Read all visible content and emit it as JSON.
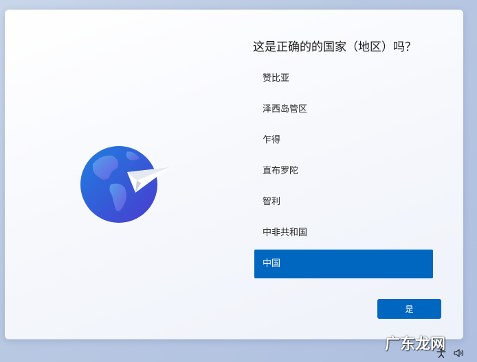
{
  "dialog": {
    "title": "这是正确的的国家（地区）吗？",
    "hero_icon": "globe-with-paper-plane-icon"
  },
  "regions": {
    "items": [
      {
        "label": "赞比亚",
        "selected": false
      },
      {
        "label": "泽西岛管区",
        "selected": false
      },
      {
        "label": "乍得",
        "selected": false
      },
      {
        "label": "直布罗陀",
        "selected": false
      },
      {
        "label": "智利",
        "selected": false
      },
      {
        "label": "中非共和国",
        "selected": false
      },
      {
        "label": "中国",
        "selected": true
      }
    ]
  },
  "actions": {
    "yes_label": "是"
  },
  "tray": {
    "icons": [
      "accessibility-icon",
      "volume-icon"
    ]
  },
  "watermark": {
    "text": "广东龙网"
  },
  "colors": {
    "accent": "#0067c0",
    "card_background": "#ffffff",
    "desktop_background": "#b9c9e2",
    "globe_dark": "#3b3fcf",
    "globe_light": "#1e7fe0"
  }
}
